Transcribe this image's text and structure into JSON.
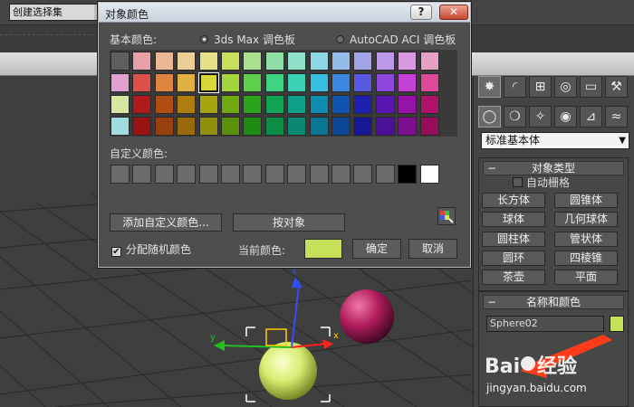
{
  "topbar": {
    "selection_set": "创建选择集"
  },
  "dialog": {
    "title": "对象颜色",
    "help_label": "?",
    "close_label": "✕",
    "basic_colors_label": "基本颜色:",
    "palette_options": [
      {
        "label": "3ds Max 调色板",
        "selected": true
      },
      {
        "label": "AutoCAD ACI 调色板",
        "selected": false
      }
    ],
    "basic_colors": [
      [
        "#5f5f5f",
        "#e8a0a8",
        "#eab896",
        "#eccf96",
        "#e6e088",
        "#c6e05a",
        "#a8e090",
        "#8fe0a6",
        "#8ee0c8",
        "#8ed8e6",
        "#94bbea",
        "#a3a3ea",
        "#bb98ea",
        "#d898e2",
        "#e8a0c4"
      ],
      [
        "#e2a0d0",
        "#e0504a",
        "#e08540",
        "#e0b040",
        "#d8d63a",
        "#a4d53a",
        "#5cd04c",
        "#3ed482",
        "#3ad0b4",
        "#38bee0",
        "#3c88e0",
        "#5858e0",
        "#8e48e0",
        "#c440d6",
        "#e04898"
      ],
      [
        "#d6e6a0",
        "#b01a1a",
        "#b04e12",
        "#b07e10",
        "#a8a410",
        "#70a810",
        "#2aa41a",
        "#12a454",
        "#0ea088",
        "#0e8cb0",
        "#1054b0",
        "#2020b0",
        "#5a16b0",
        "#9612a8",
        "#b0126a"
      ],
      [
        "#9edce0",
        "#981414",
        "#98400e",
        "#986a0c",
        "#90900c",
        "#5a900c",
        "#1e8c14",
        "#0c8c44",
        "#0a8872",
        "#0a7696",
        "#0c4696",
        "#181896",
        "#4c1096",
        "#7e0e90",
        "#960e5a"
      ]
    ],
    "selected_swatch": {
      "row": 1,
      "col": 4
    },
    "custom_colors_label": "自定义颜色:",
    "custom_colors": [
      "#6b6b6b",
      "#6b6b6b",
      "#6b6b6b",
      "#6b6b6b",
      "#6b6b6b",
      "#6b6b6b",
      "#6b6b6b",
      "#6b6b6b",
      "#6b6b6b",
      "#6b6b6b",
      "#6b6b6b",
      "#6b6b6b",
      "#6b6b6b",
      "#000000",
      "#ffffff"
    ],
    "add_custom_label": "添加自定义颜色...",
    "by_object_label": "按对象",
    "random_label": "分配随机颜色",
    "random_checked": true,
    "current_color_label": "当前颜色:",
    "current_color": "#c6e05a",
    "ok_label": "确定",
    "cancel_label": "取消"
  },
  "command_panel": {
    "primitive_dropdown": "标准基本体",
    "object_type": {
      "header": "对象类型",
      "autogrid": "自动栅格",
      "buttons": [
        "长方体",
        "圆锥体",
        "球体",
        "几何球体",
        "圆柱体",
        "管状体",
        "圆环",
        "四棱锥",
        "茶壶",
        "平面"
      ]
    },
    "name_color": {
      "header": "名称和颜色",
      "object_name": "Sphere02",
      "object_color": "#c6e05a"
    }
  },
  "watermark": {
    "url": "jingyan.baidu.com"
  }
}
